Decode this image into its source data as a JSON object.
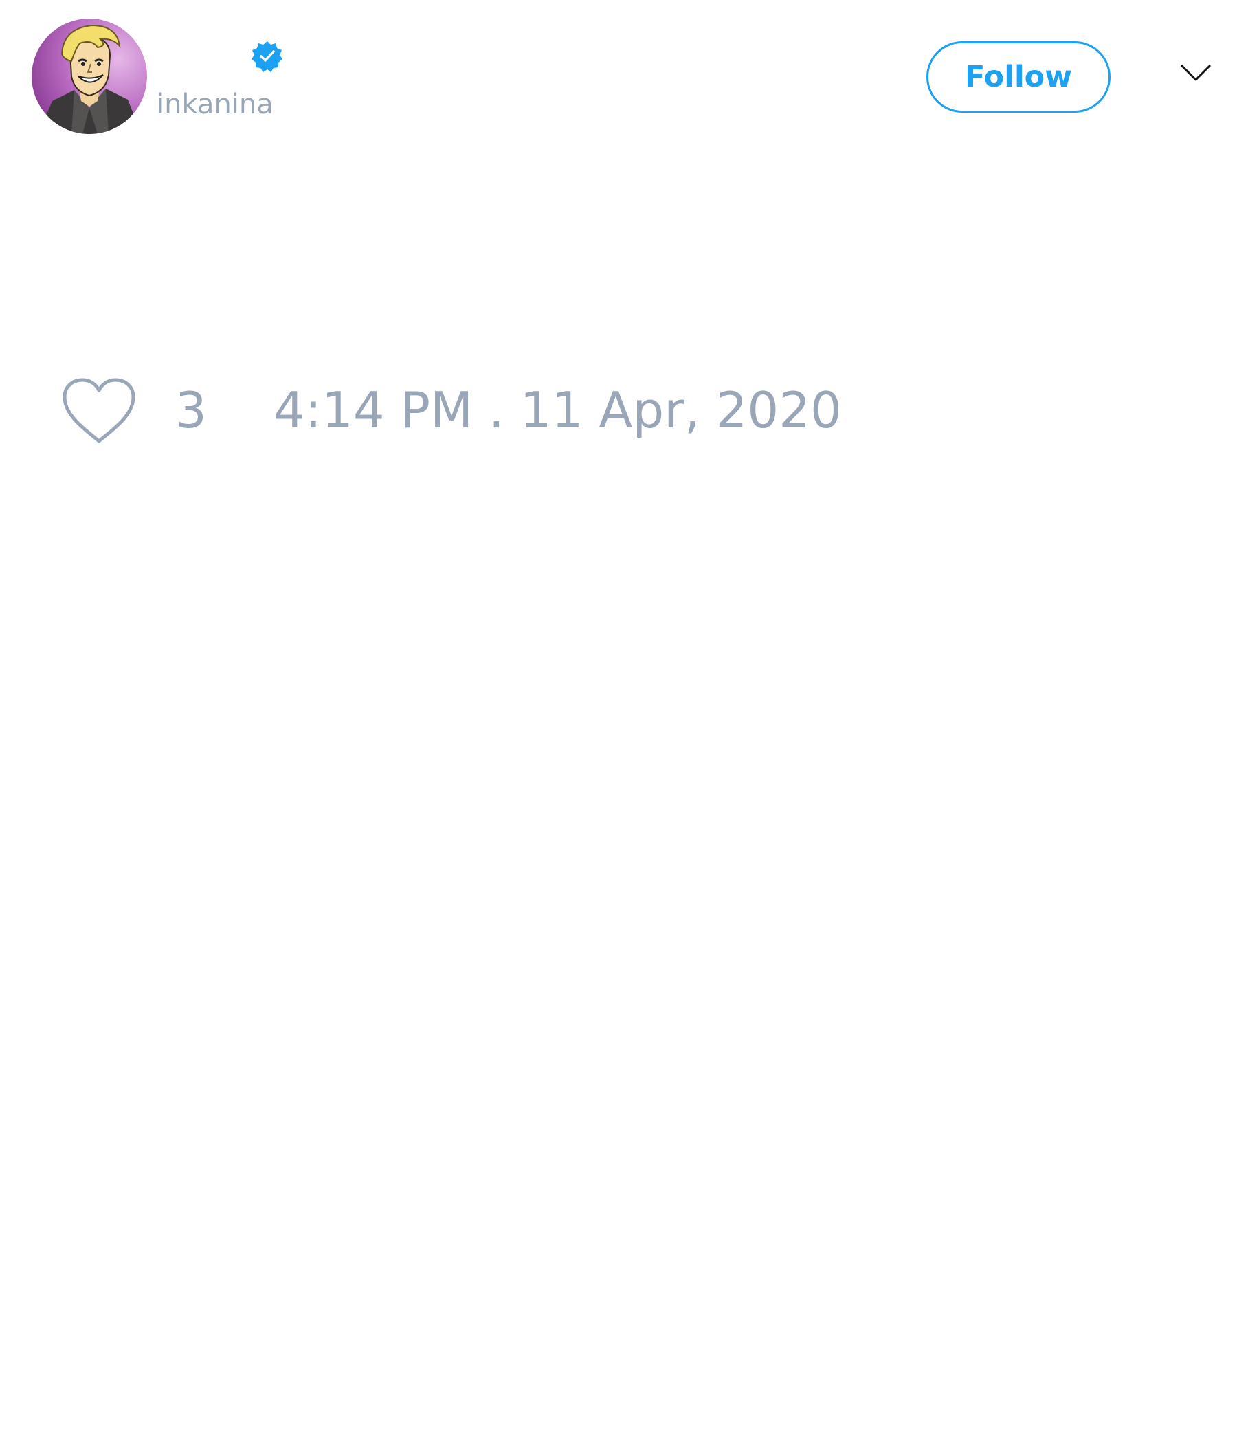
{
  "author": {
    "handle": "inkanina",
    "verified": true
  },
  "actions": {
    "follow_label": "Follow"
  },
  "engagement": {
    "like_count": "3"
  },
  "tweet": {
    "timestamp": "4:14 PM . 11 Apr, 2020"
  },
  "icons": {
    "verified": "verified-badge-icon",
    "menu": "chevron-down-icon",
    "like": "heart-icon"
  },
  "colors": {
    "accent": "#1da1f2",
    "muted_text": "#98a6b7",
    "background": "#ffffff"
  }
}
